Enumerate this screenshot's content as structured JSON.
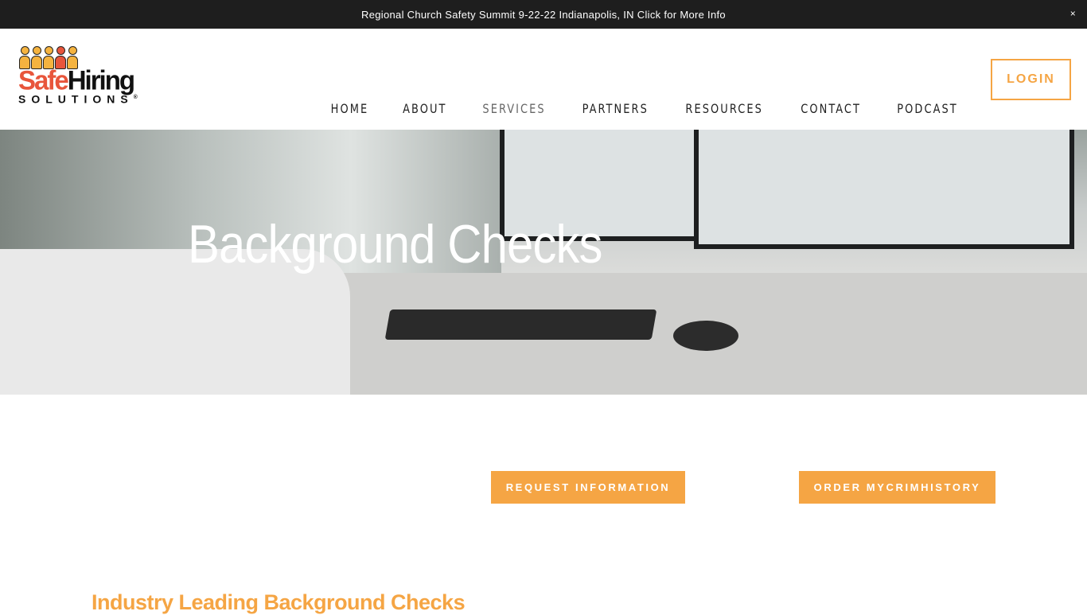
{
  "announcement": {
    "text": "Regional Church Safety Summit 9-22-22 Indianapolis, IN Click for More Info",
    "close": "×"
  },
  "logo": {
    "safe": "Safe",
    "hiring": "Hiring",
    "solutions": "SOLUTIONS",
    "registered": "®"
  },
  "nav": [
    {
      "label": "HOME"
    },
    {
      "label": "ABOUT"
    },
    {
      "label": "SERVICES"
    },
    {
      "label": "PARTNERS"
    },
    {
      "label": "RESOURCES"
    },
    {
      "label": "CONTACT"
    },
    {
      "label": "PODCAST"
    }
  ],
  "login_label": "LOGIN",
  "hero": {
    "title": "Background Checks"
  },
  "buttons": {
    "request": "REQUEST INFORMATION",
    "order": "ORDER MYCRIMHISTORY"
  },
  "section_heading": "Industry Leading Background Checks",
  "colors": {
    "accent": "#f5a544",
    "logo_red": "#e8553b",
    "topbar": "#1e1e1e"
  }
}
